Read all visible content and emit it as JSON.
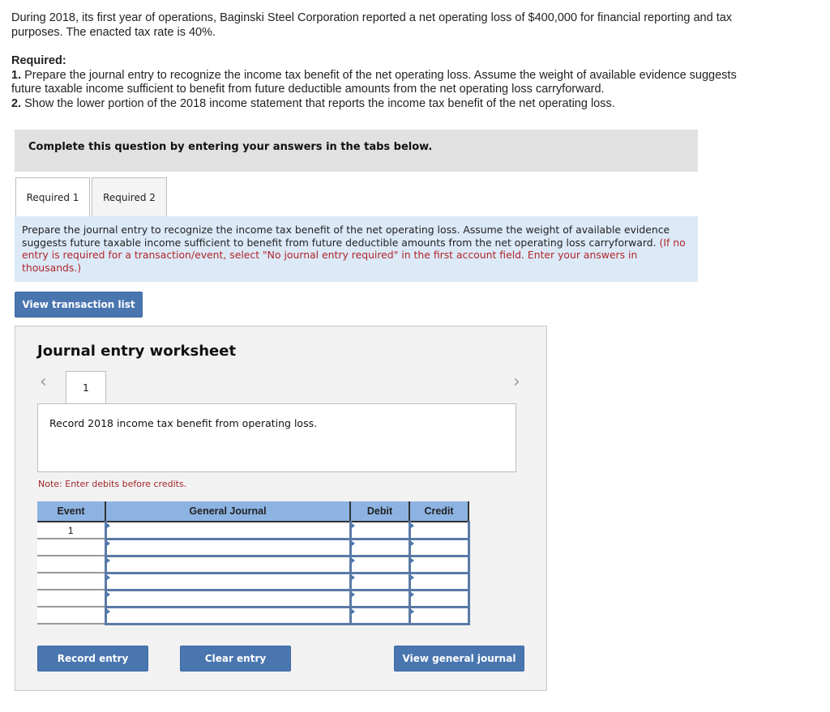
{
  "problem": {
    "intro": "During 2018, its first year of operations, Baginski Steel Corporation reported a net operating loss of $400,000 for financial reporting and tax purposes. The enacted tax rate is 40%.",
    "required_heading": "Required:",
    "requirements": [
      {
        "num": "1.",
        "text": " Prepare the journal entry to recognize the income tax benefit of the net operating loss. Assume the weight of available evidence suggests future taxable income sufficient to benefit from future deductible amounts from the net operating loss carryforward."
      },
      {
        "num": "2.",
        "text": " Show the lower portion of the 2018 income statement that reports the income tax benefit of the net operating loss."
      }
    ]
  },
  "banner": "Complete this question by entering your answers in the tabs below.",
  "tabs": [
    {
      "label": "Required 1",
      "active": true
    },
    {
      "label": "Required 2",
      "active": false
    }
  ],
  "instructions": {
    "text": "Prepare the journal entry to recognize the income tax benefit of the net operating loss. Assume the weight of available evidence suggests future taxable income sufficient to benefit from future deductible amounts from the net operating loss carryforward. ",
    "note": "(If no entry is required for a transaction/event, select \"No journal entry required\" in the first account field. Enter your answers in thousands.)"
  },
  "buttons": {
    "view_transaction_list": "View transaction list",
    "record_entry": "Record entry",
    "clear_entry": "Clear entry",
    "view_general_journal": "View general journal"
  },
  "worksheet": {
    "title": "Journal entry worksheet",
    "prev_icon": "chevron-left",
    "next_icon": "chevron-right",
    "current_entry": "1",
    "description": "Record 2018 income tax benefit from operating loss.",
    "note": "Note: Enter debits before credits.",
    "table": {
      "headers": [
        "Event",
        "General Journal",
        "Debit",
        "Credit"
      ],
      "rows": [
        {
          "event": "1",
          "account": "",
          "debit": "",
          "credit": ""
        },
        {
          "event": "",
          "account": "",
          "debit": "",
          "credit": ""
        },
        {
          "event": "",
          "account": "",
          "debit": "",
          "credit": ""
        },
        {
          "event": "",
          "account": "",
          "debit": "",
          "credit": ""
        },
        {
          "event": "",
          "account": "",
          "debit": "",
          "credit": ""
        },
        {
          "event": "",
          "account": "",
          "debit": "",
          "credit": ""
        }
      ]
    }
  },
  "colors": {
    "button": "#4a76b0",
    "table_header": "#8db3e2",
    "instruction_bg": "#dce9f7",
    "note_red": "#b1262a",
    "banner_bg": "#e1e1e1",
    "worksheet_bg": "#f2f2f2"
  }
}
